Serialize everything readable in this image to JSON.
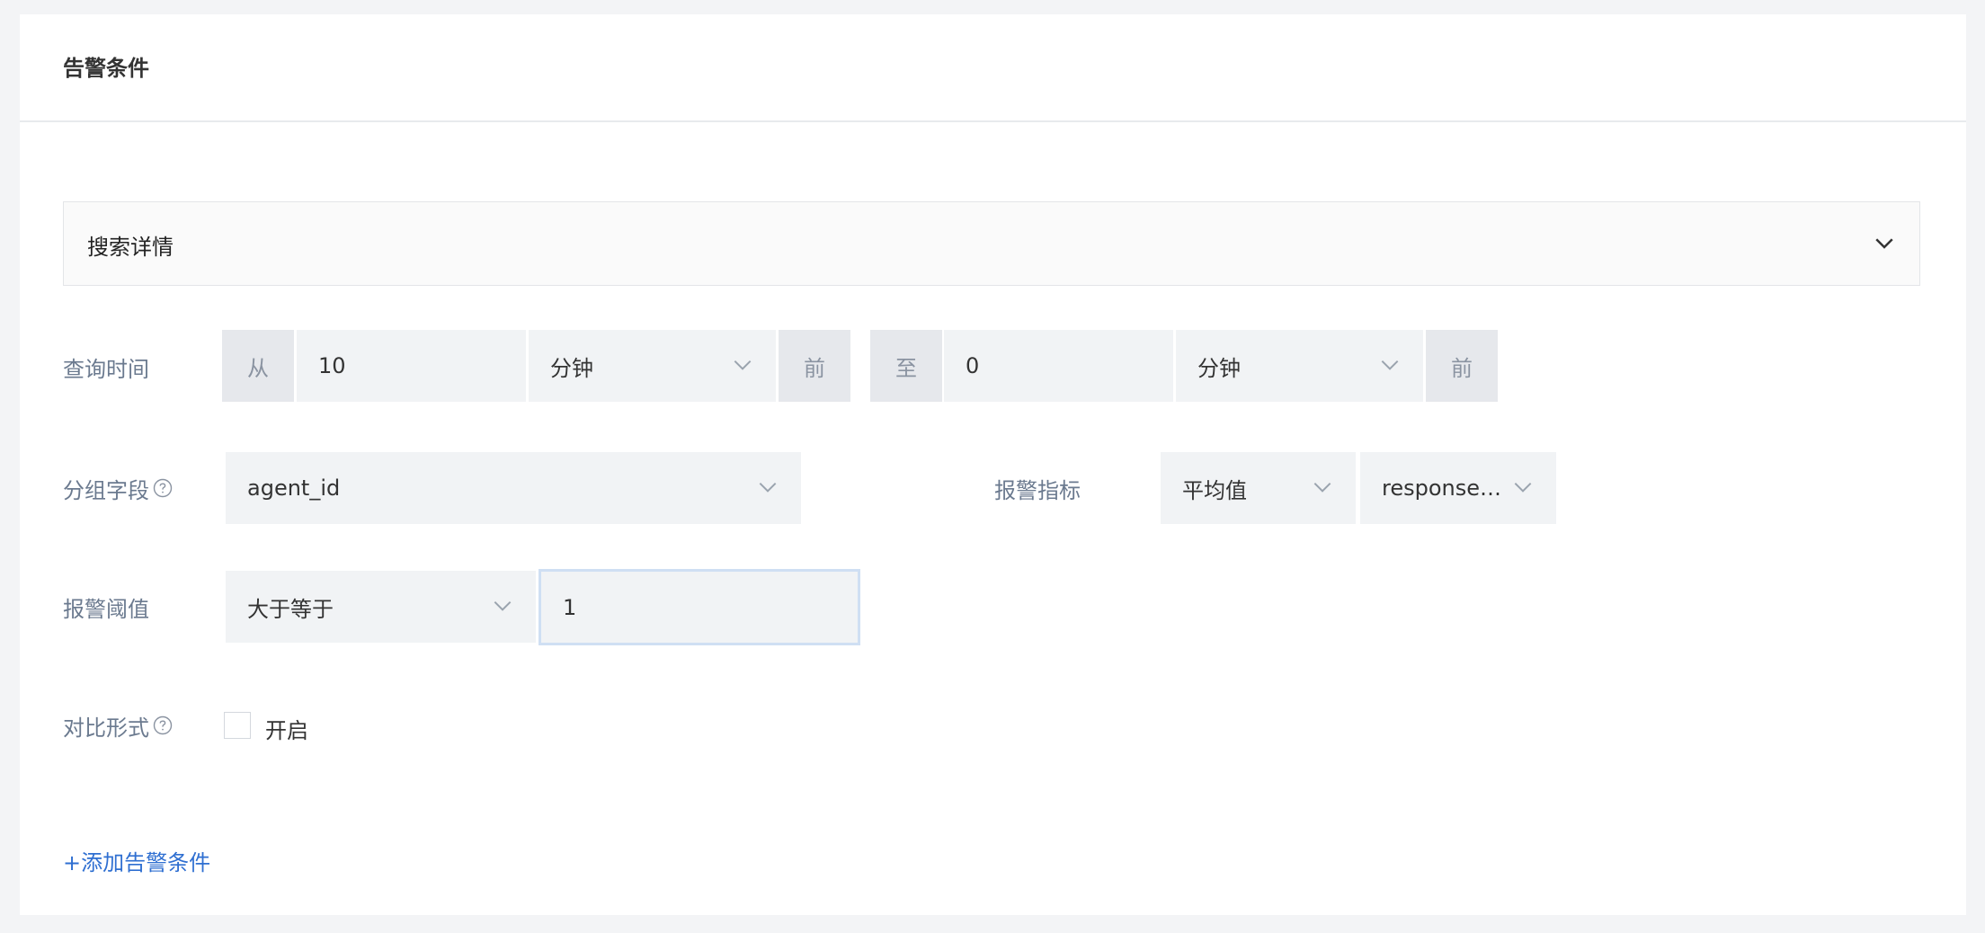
{
  "panel": {
    "title": "告警条件"
  },
  "search_details": {
    "label": "搜索详情"
  },
  "query_time": {
    "label": "查询时间",
    "from_prefix": "从",
    "from_value": "10",
    "from_unit": "分钟",
    "from_suffix": "前",
    "to_prefix": "至",
    "to_value": "0",
    "to_unit": "分钟",
    "to_suffix": "前"
  },
  "group_field": {
    "label": "分组字段",
    "value": "agent_id"
  },
  "alert_metric": {
    "label": "报警指标",
    "aggregation": "平均值",
    "field": "response…"
  },
  "alert_threshold": {
    "label": "报警阈值",
    "operator": "大于等于",
    "value": "1"
  },
  "compare_mode": {
    "label": "对比形式",
    "checkbox_label": "开启",
    "checked": false
  },
  "add_condition": {
    "label": "+添加告警条件"
  },
  "colors": {
    "accent": "#2f6fd1",
    "label": "#6b7a8f",
    "field_bg": "#f1f3f5",
    "addon_bg": "#e6e8ec"
  }
}
